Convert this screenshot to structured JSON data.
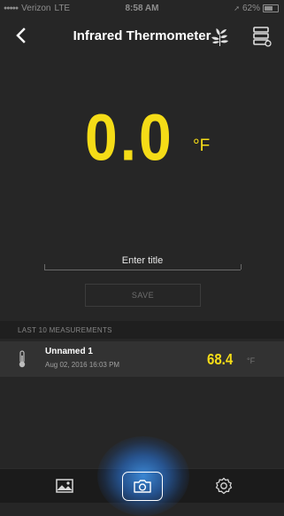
{
  "status_bar": {
    "carrier": "Verizon",
    "network": "LTE",
    "time": "8:58 AM",
    "battery": "62%"
  },
  "nav": {
    "title": "Infrared Thermometer"
  },
  "reading": {
    "value": "0.0",
    "unit": "°F"
  },
  "title_field": {
    "placeholder": "Enter title",
    "value": ""
  },
  "save_label": "SAVE",
  "measurements": {
    "header": "LAST 10 MEASUREMENTS",
    "items": [
      {
        "name": "Unnamed 1",
        "date": "Aug 02, 2016 16:03 PM",
        "value": "68.4",
        "unit": "°F"
      }
    ]
  },
  "tabs": [
    {
      "icon": "gallery-icon"
    },
    {
      "icon": "camera-icon",
      "active": true
    },
    {
      "icon": "settings-icon"
    }
  ],
  "colors": {
    "accent": "#f5dc17",
    "background": "#262626",
    "tab_glow": "#3c8cdc"
  }
}
